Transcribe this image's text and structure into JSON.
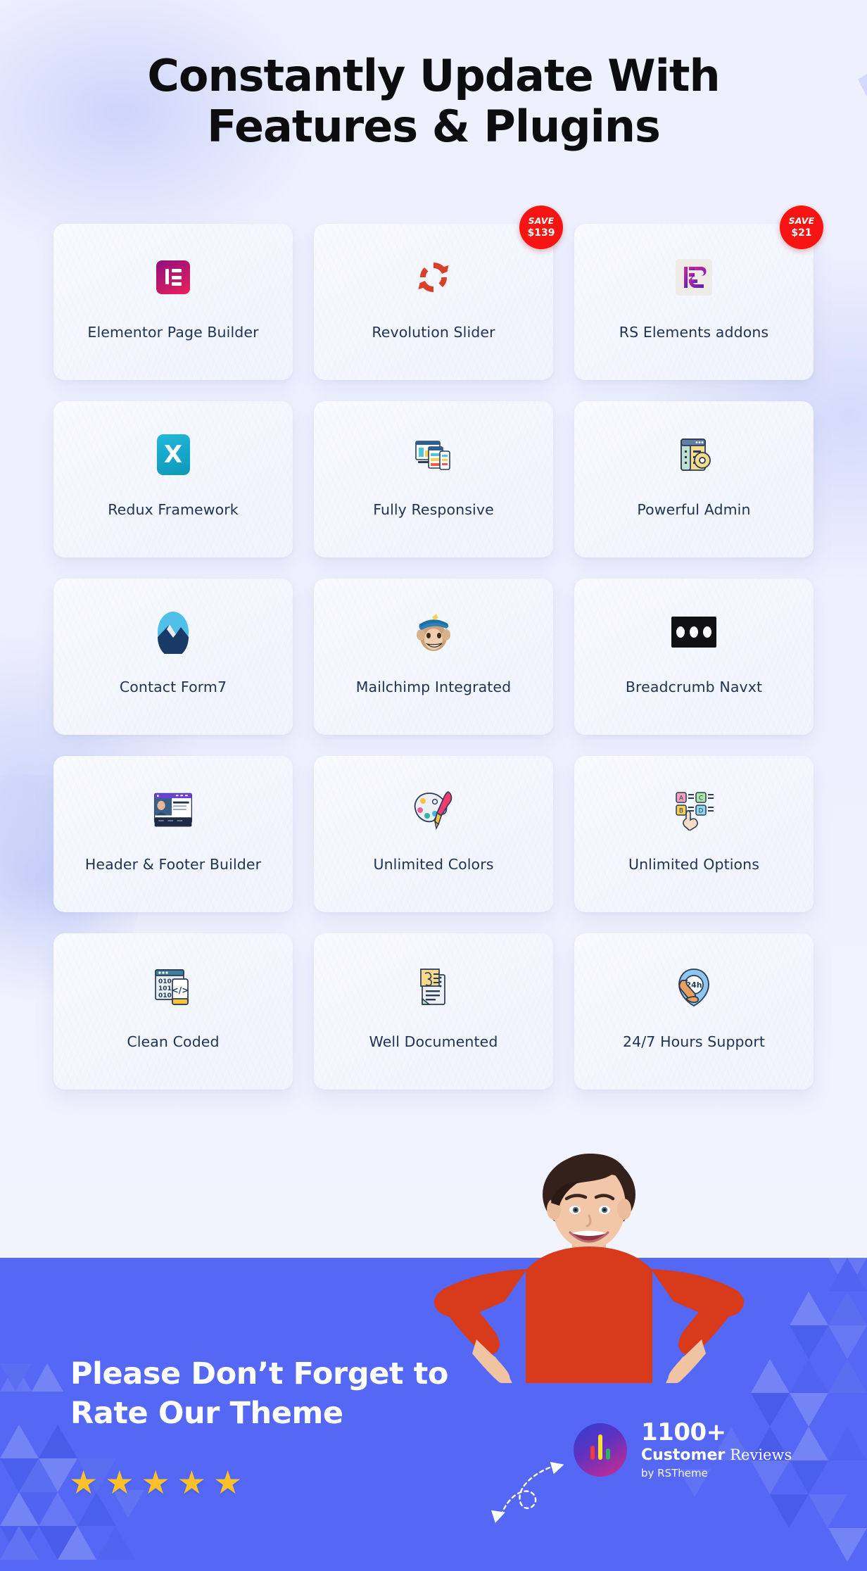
{
  "heading": {
    "line1": "Constantly Update With",
    "line2": "Features & Plugins"
  },
  "colors": {
    "page_bg": "#eef1fd",
    "card_bg": "#f4f7fd",
    "card_label": "#1f3251",
    "heading": "#0d0d10",
    "cta_band": "#5468f5",
    "save_badge": "#f91414",
    "star": "#fcc12a"
  },
  "features": [
    {
      "label": "Elementor Page Builder",
      "icon": "elementor-icon",
      "badge": null
    },
    {
      "label": "Revolution Slider",
      "icon": "revolution-slider-icon",
      "badge": {
        "title": "SAVE",
        "amount": "$139"
      }
    },
    {
      "label": "RS Elements addons",
      "icon": "rs-elements-icon",
      "badge": {
        "title": "SAVE",
        "amount": "$21"
      }
    },
    {
      "label": "Redux Framework",
      "icon": "redux-icon",
      "badge": null
    },
    {
      "label": "Fully Responsive",
      "icon": "responsive-devices-icon",
      "badge": null
    },
    {
      "label": "Powerful Admin",
      "icon": "admin-gear-icon",
      "badge": null
    },
    {
      "label": "Contact Form7",
      "icon": "contact-form7-icon",
      "badge": null
    },
    {
      "label": "Mailchimp Integrated",
      "icon": "mailchimp-monkey-icon",
      "badge": null
    },
    {
      "label": "Breadcrumb Navxt",
      "icon": "breadcrumb-navxt-icon",
      "badge": null
    },
    {
      "label": "Header & Footer Builder",
      "icon": "header-footer-builder-icon",
      "badge": null
    },
    {
      "label": "Unlimited Colors",
      "icon": "color-palette-icon",
      "badge": null
    },
    {
      "label": "Unlimited Options",
      "icon": "options-hand-icon",
      "badge": null
    },
    {
      "label": "Clean Coded",
      "icon": "clean-code-icon",
      "badge": null
    },
    {
      "label": "Well Documented",
      "icon": "document-icon",
      "badge": null
    },
    {
      "label": "24/7 Hours Support",
      "icon": "support-24h-icon",
      "badge": null
    }
  ],
  "cta": {
    "line1": "Please Don’t Forget to",
    "line2": "Rate Our Theme",
    "stars": 5,
    "star_glyph": "★"
  },
  "reviews": {
    "count": "1100+",
    "label_bold": "Customer",
    "label_serif": "Reviews",
    "by": "by RSTheme"
  }
}
